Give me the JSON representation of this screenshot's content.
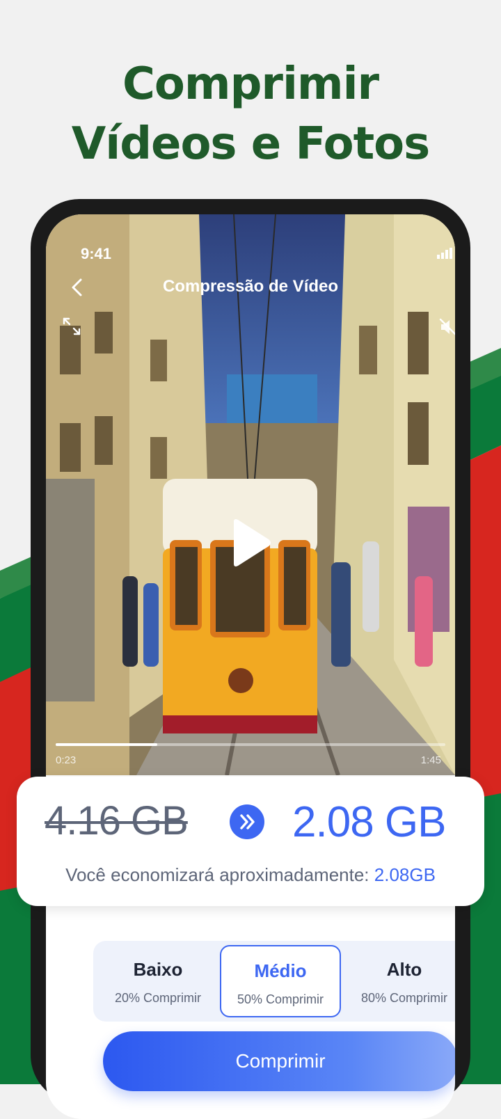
{
  "headline": {
    "line1": "Comprimir",
    "line2": "Vídeos e Fotos"
  },
  "status_bar": {
    "time": "9:41"
  },
  "nav": {
    "title": "Compressão de Vídeo"
  },
  "player": {
    "current_time": "0:23",
    "total_time": "1:45",
    "progress": 0.26
  },
  "sizes": {
    "original": "4.16 GB",
    "compressed": "2.08 GB",
    "savings_label": "Você economizará aproximadamente: ",
    "savings_value": "2.08GB"
  },
  "options": [
    {
      "label": "Baixo",
      "sub": "20% Comprimir"
    },
    {
      "label": "Médio",
      "sub": "50% Comprimir",
      "selected": true
    },
    {
      "label": "Alto",
      "sub": "80% Comprimir"
    }
  ],
  "cta": {
    "label": "Comprimir"
  },
  "colors": {
    "brand_green": "#1f5a2a",
    "accent_blue": "#3d67f2",
    "flag_green": "#0b7a3a",
    "flag_red": "#d7261f"
  },
  "icons": [
    "back-chevron-icon",
    "expand-icon",
    "mute-icon",
    "play-icon",
    "signal-icon",
    "wifi-icon",
    "battery-icon",
    "double-chevron-right-icon"
  ]
}
